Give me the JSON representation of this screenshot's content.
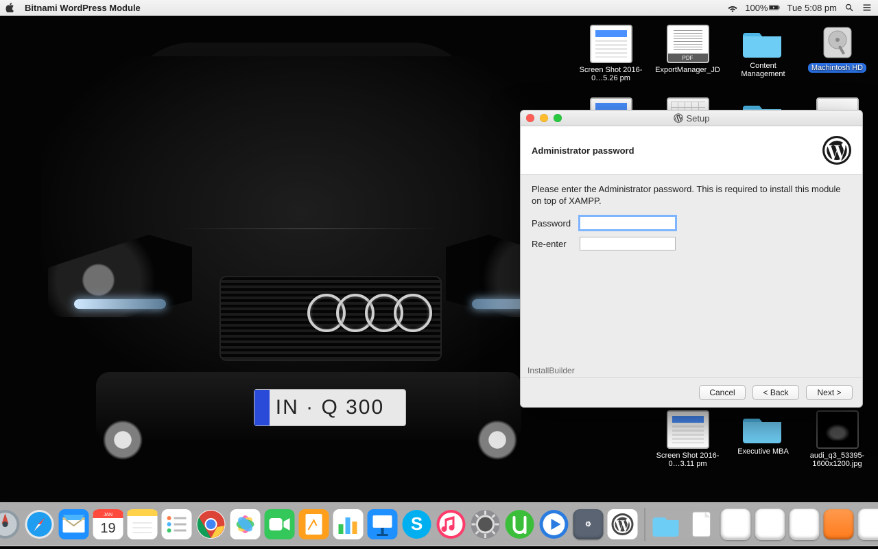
{
  "menubar": {
    "app_name": "Bitnami WordPress Module",
    "battery_pct": "100%",
    "clock": "Tue 5:08 pm"
  },
  "desktop_icons": {
    "row1": {
      "screenshot1": "Screen Shot 2016-0…5.26 pm",
      "pdf1": "ExportManager_JD",
      "folder1": "Content Management",
      "hd": "Machintosh HD"
    },
    "row3": {
      "screenshot2": "Screen Shot 2016-0…3.11 pm",
      "folder2": "Executive MBA",
      "image1": "audi_q3_53395-1600x1200.jpg"
    },
    "plate": "IN · Q 300"
  },
  "setup": {
    "window_title": "Setup",
    "heading": "Administrator password",
    "instructions": "Please enter the Administrator password. This is required to install this module on top of XAMPP.",
    "label_password": "Password",
    "label_reenter": "Re-enter",
    "value_password": "",
    "value_reenter": "",
    "footer_brand": "InstallBuilder",
    "btn_cancel": "Cancel",
    "btn_back": "< Back",
    "btn_next": "Next >"
  },
  "dock": {}
}
